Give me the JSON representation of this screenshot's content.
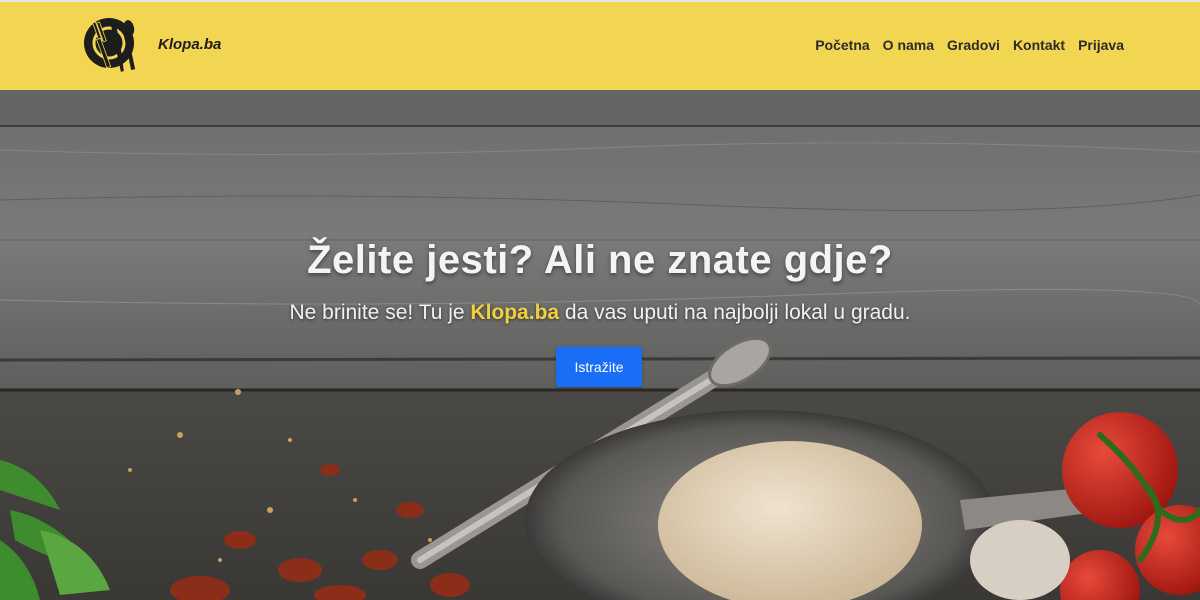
{
  "header": {
    "brand": "Klopa.ba",
    "logo_icon": "fork-knife-spoon-icon",
    "nav": [
      {
        "label": "Početna"
      },
      {
        "label": "O nama"
      },
      {
        "label": "Gradovi"
      },
      {
        "label": "Kontakt"
      },
      {
        "label": "Prijava"
      }
    ]
  },
  "hero": {
    "headline": "Želite jesti? Ali ne znate gdje?",
    "sub_before": "Ne brinite se! Tu je ",
    "sub_brand": "Klopa.ba",
    "sub_after": " da vas uputi na najbolji lokal u gradu.",
    "cta_label": "Istražite"
  },
  "colors": {
    "header_bg": "#f2d550",
    "accent": "#f2cf3f",
    "cta": "#1a6ef5"
  }
}
